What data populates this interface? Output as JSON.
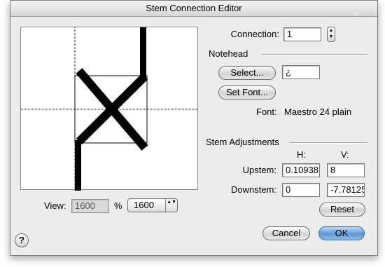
{
  "window": {
    "title": "Stem Connection Editor"
  },
  "connection": {
    "label": "Connection:",
    "value": "1",
    "stepper_up": "▲",
    "stepper_down": "▼"
  },
  "notehead": {
    "section": "Notehead",
    "select_label": "Select...",
    "character": "¿",
    "set_font_label": "Set Font...",
    "font_label": "Font:",
    "font_value": "Maestro 24 plain"
  },
  "stem_adjustments": {
    "section": "Stem Adjustments",
    "h_header": "H:",
    "v_header": "V:",
    "upstem": {
      "label": "Upstem:",
      "h": "0.10938",
      "v": "8"
    },
    "downstem": {
      "label": "Downstem:",
      "h": "0",
      "v": "-7.78125"
    },
    "reset_label": "Reset"
  },
  "view": {
    "label": "View:",
    "value": "1600",
    "percent": "%",
    "popup_value": "1600",
    "popup_arrows": "▲▼"
  },
  "buttons": {
    "help": "?",
    "cancel": "Cancel",
    "ok": "OK"
  },
  "icons": {
    "help": "help-icon",
    "stepper": "stepper-arrows-icon",
    "popup": "popup-arrows-icon"
  }
}
